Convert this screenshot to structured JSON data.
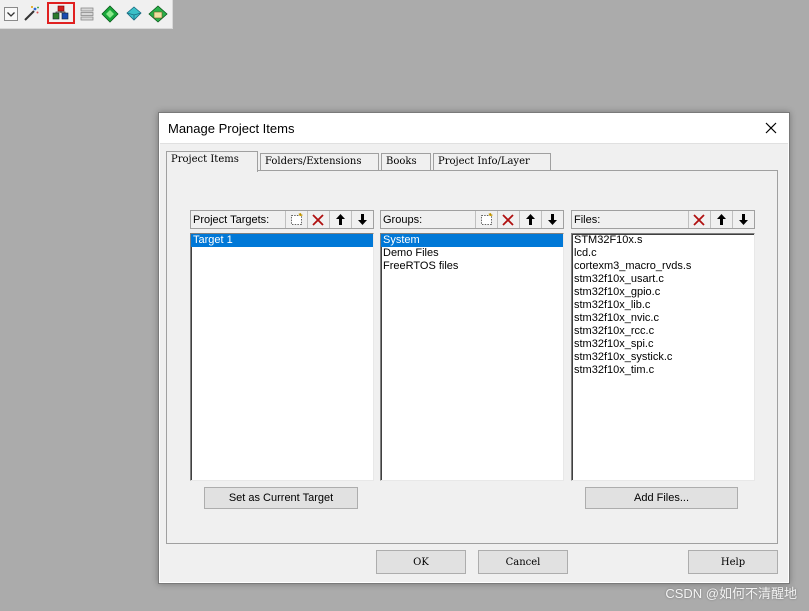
{
  "toolbar": {
    "items": [
      {
        "icon": "dropdown-arrow-icon"
      },
      {
        "icon": "magic-wand-icon"
      },
      {
        "icon": "manage-project-items-icon",
        "active": true
      },
      {
        "icon": "stacked-layers-icon"
      },
      {
        "icon": "green-diamond-icon"
      },
      {
        "icon": "diamond-pack-icon"
      },
      {
        "icon": "multi-project-icon"
      }
    ]
  },
  "dialog": {
    "title": "Manage Project Items",
    "tabs": [
      {
        "label": "Project Items",
        "active": true
      },
      {
        "label": "Folders/Extensions",
        "active": false
      },
      {
        "label": "Books",
        "active": false
      },
      {
        "label": "Project Info/Layer",
        "active": false
      }
    ],
    "targets": {
      "label": "Project Targets:",
      "items": [
        {
          "text": "Target 1",
          "selected": true
        }
      ]
    },
    "groups": {
      "label": "Groups:",
      "items": [
        {
          "text": "System",
          "selected": true
        },
        {
          "text": "Demo Files",
          "selected": false
        },
        {
          "text": "FreeRTOS files",
          "selected": false
        }
      ]
    },
    "files": {
      "label": "Files:",
      "items": [
        {
          "text": "STM32F10x.s"
        },
        {
          "text": "lcd.c"
        },
        {
          "text": "cortexm3_macro_rvds.s"
        },
        {
          "text": "stm32f10x_usart.c"
        },
        {
          "text": "stm32f10x_gpio.c"
        },
        {
          "text": "stm32f10x_lib.c"
        },
        {
          "text": "stm32f10x_nvic.c"
        },
        {
          "text": "stm32f10x_rcc.c"
        },
        {
          "text": "stm32f10x_spi.c"
        },
        {
          "text": "stm32f10x_systick.c"
        },
        {
          "text": "stm32f10x_tim.c"
        }
      ]
    },
    "set_current_target_label": "Set as Current Target",
    "add_files_label": "Add Files...",
    "ok_label": "OK",
    "cancel_label": "Cancel",
    "help_label": "Help"
  },
  "watermark": "CSDN  @如何不清醒地",
  "colors": {
    "selection": "#0078d7",
    "desktop": "#ababab",
    "highlight_border": "#e02020"
  }
}
